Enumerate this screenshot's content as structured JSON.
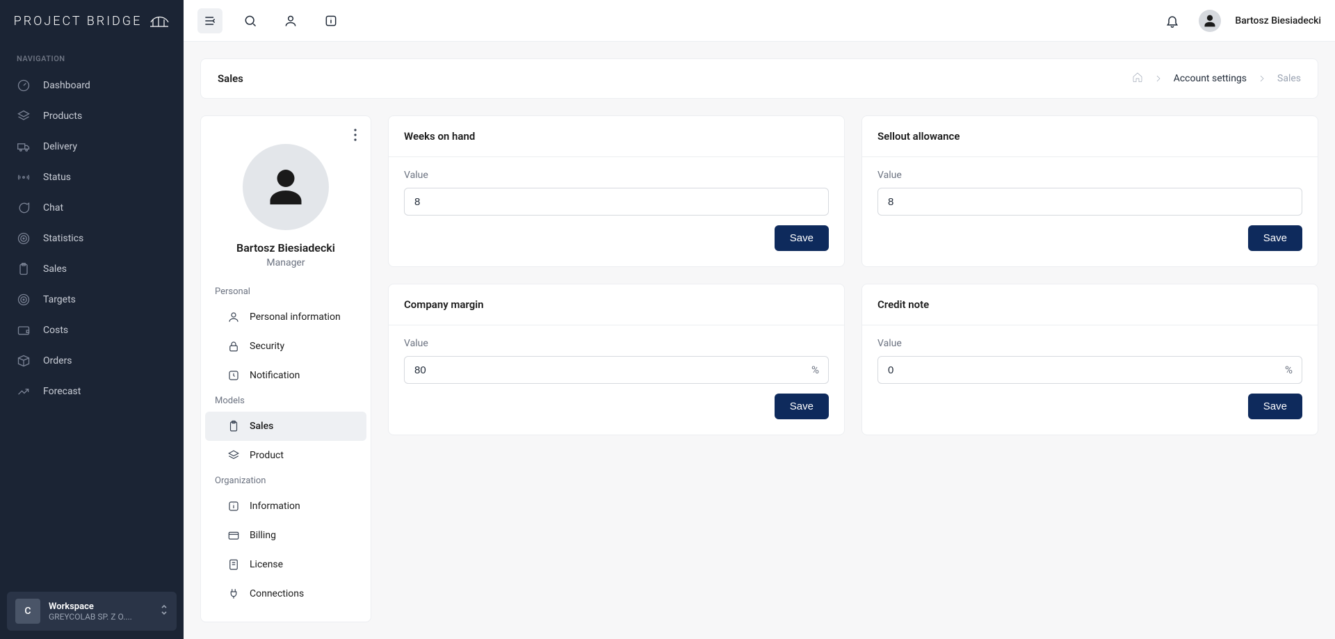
{
  "brand": "PROJECT BRIDGE",
  "nav_heading": "NAVIGATION",
  "nav": [
    {
      "label": "Dashboard",
      "name": "dashboard",
      "icon": "gauge"
    },
    {
      "label": "Products",
      "name": "products",
      "icon": "layers"
    },
    {
      "label": "Delivery",
      "name": "delivery",
      "icon": "truck"
    },
    {
      "label": "Status",
      "name": "status",
      "icon": "broadcast"
    },
    {
      "label": "Chat",
      "name": "chat",
      "icon": "chat"
    },
    {
      "label": "Statistics",
      "name": "statistics",
      "icon": "target"
    },
    {
      "label": "Sales",
      "name": "sales",
      "icon": "clipboard"
    },
    {
      "label": "Targets",
      "name": "targets",
      "icon": "target"
    },
    {
      "label": "Costs",
      "name": "costs",
      "icon": "wallet"
    },
    {
      "label": "Orders",
      "name": "orders",
      "icon": "box"
    },
    {
      "label": "Forecast",
      "name": "forecast",
      "icon": "trend"
    }
  ],
  "workspace": {
    "avatar_letter": "C",
    "title": "Workspace",
    "subtitle": "GREYCOLAB SP. Z O...."
  },
  "topbar": {
    "user_name": "Bartosz Biesiadecki"
  },
  "page": {
    "title": "Sales",
    "breadcrumb": {
      "mid": "Account settings",
      "current": "Sales"
    }
  },
  "profile": {
    "name": "Bartosz Biesiadecki",
    "role": "Manager",
    "sections": {
      "personal": {
        "label": "Personal",
        "items": [
          {
            "label": "Personal information",
            "name": "personal-information",
            "icon": "user"
          },
          {
            "label": "Security",
            "name": "security",
            "icon": "lock"
          },
          {
            "label": "Notification",
            "name": "notification",
            "icon": "bell-square"
          }
        ]
      },
      "models": {
        "label": "Models",
        "items": [
          {
            "label": "Sales",
            "name": "sales",
            "icon": "clipboard",
            "active": true
          },
          {
            "label": "Product",
            "name": "product",
            "icon": "layers"
          }
        ]
      },
      "organization": {
        "label": "Organization",
        "items": [
          {
            "label": "Information",
            "name": "information",
            "icon": "info"
          },
          {
            "label": "Billing",
            "name": "billing",
            "icon": "card"
          },
          {
            "label": "License",
            "name": "license",
            "icon": "license"
          },
          {
            "label": "Connections",
            "name": "connections",
            "icon": "plug"
          }
        ]
      }
    }
  },
  "cards": {
    "weeks_on_hand": {
      "title": "Weeks on hand",
      "label": "Value",
      "value": "8",
      "save": "Save"
    },
    "sellout_allowance": {
      "title": "Sellout allowance",
      "label": "Value",
      "value": "8",
      "save": "Save"
    },
    "company_margin": {
      "title": "Company margin",
      "label": "Value",
      "value": "80",
      "suffix": "%",
      "save": "Save"
    },
    "credit_note": {
      "title": "Credit note",
      "label": "Value",
      "value": "0",
      "suffix": "%",
      "save": "Save"
    }
  }
}
